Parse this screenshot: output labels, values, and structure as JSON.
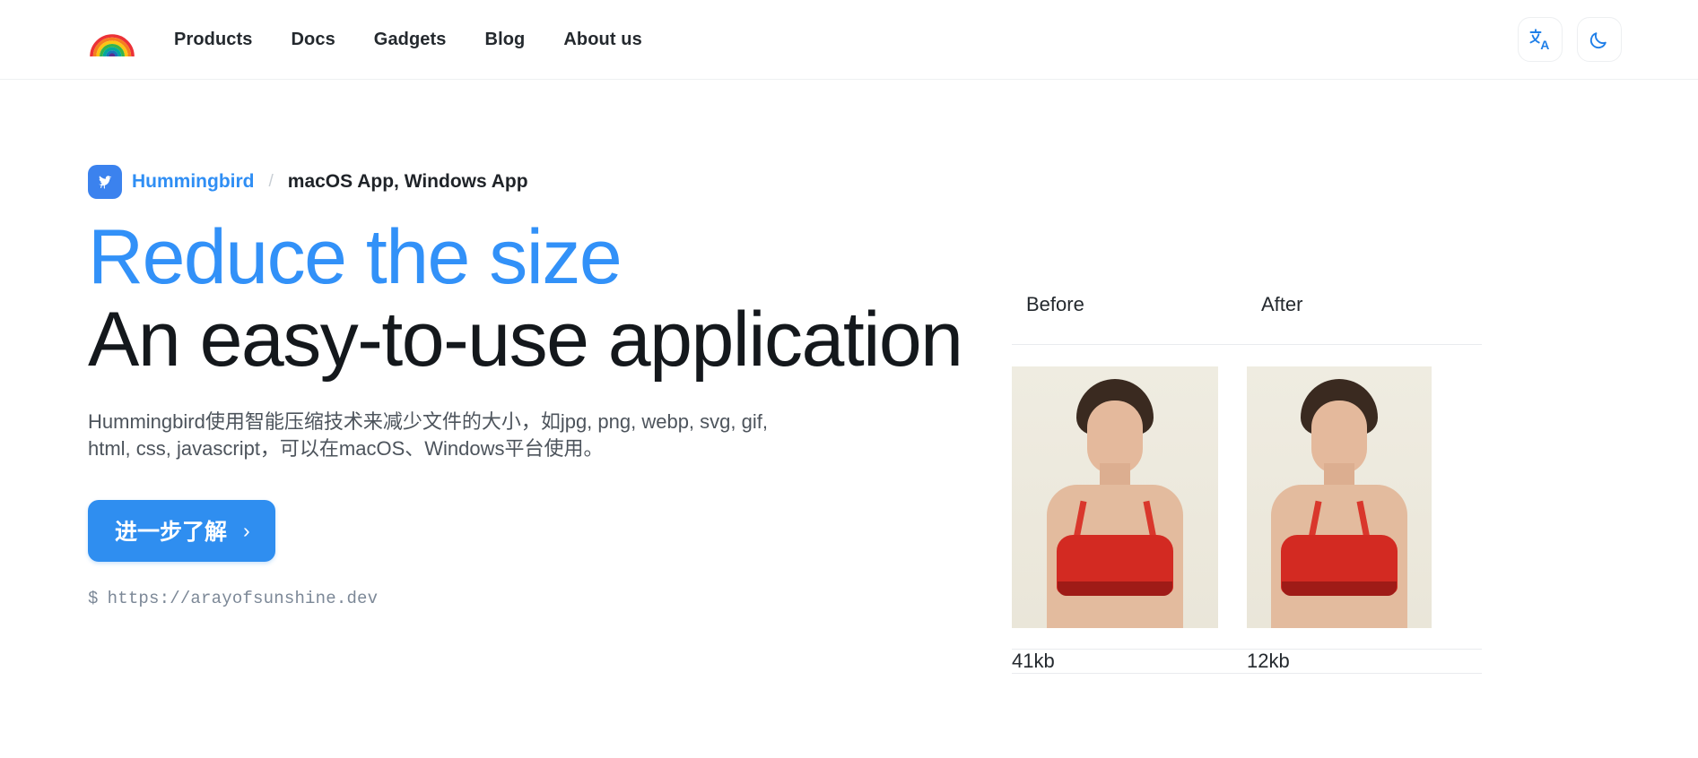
{
  "header": {
    "logo_icon": "rainbow-logo",
    "nav": [
      {
        "label": "Products"
      },
      {
        "label": "Docs"
      },
      {
        "label": "Gadgets"
      },
      {
        "label": "Blog"
      },
      {
        "label": "About us"
      }
    ],
    "actions": [
      {
        "name": "language-toggle",
        "icon": "translate-icon"
      },
      {
        "name": "theme-toggle",
        "icon": "moon-icon"
      }
    ]
  },
  "hero": {
    "breadcrumb": {
      "app_icon": "hummingbird-bird-icon",
      "app_name": "Hummingbird",
      "separator": "/",
      "platforms": "macOS App, Windows App"
    },
    "headline_accent": "Reduce the size",
    "headline_main": "An easy-to-use application",
    "description": "Hummingbird使用智能压缩技术来减少文件的大小，如jpg, png, webp, svg, gif, html, css, javascript，可以在macOS、Windows平台使用。",
    "cta_label": "进一步了解",
    "cta_chevron": "›",
    "terminal_prompt": "$",
    "terminal_url": "https://arayofsunshine.dev"
  },
  "comparison": {
    "columns": [
      {
        "header": "Before",
        "size": "41kb",
        "image_alt": "before-compression-photo"
      },
      {
        "header": "After",
        "size": "12kb",
        "image_alt": "after-compression-photo"
      }
    ]
  },
  "colors": {
    "accent_blue": "#3291f8",
    "button_blue": "#2f8ef0",
    "text_dark": "#14181c",
    "text_body": "#4d545c",
    "border_light": "#e9ebee"
  }
}
